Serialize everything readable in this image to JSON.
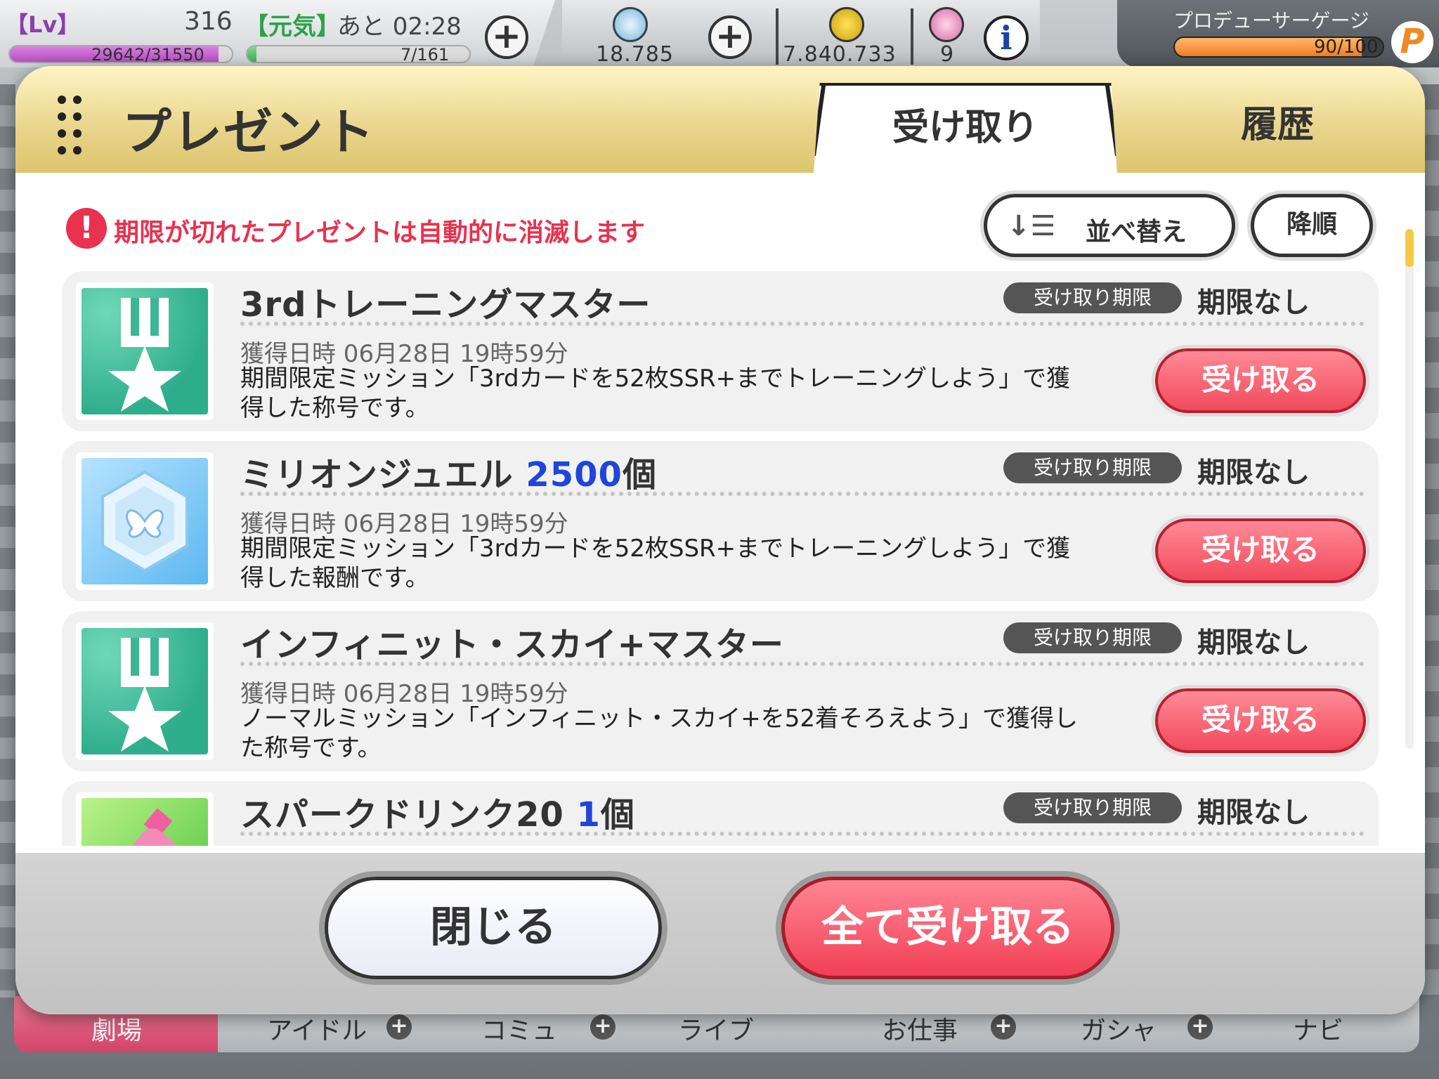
{
  "status": {
    "lv_badge": "【Lv】",
    "level": "316",
    "genki": "【元気】",
    "time_left": "あと 02:28",
    "exp_text": "29642/31550",
    "exp_ratio": 0.94,
    "stamina_text": "7/161",
    "stamina_ratio": 0.04
  },
  "currency": {
    "jewels": "18.785",
    "money": "7.840.733",
    "tickets": "9"
  },
  "producer": {
    "label": "プロデューサーゲージ",
    "gauge_text": "90/100",
    "gauge_ratio": 0.9,
    "icon_letter": "P"
  },
  "modal": {
    "title": "プレゼント",
    "tabs": {
      "receive": "受け取り",
      "history": "履歴"
    },
    "warning": "期限が切れたプレゼントは自動的に消滅します",
    "sort_icon": "↓☰",
    "sort_label": "並べ替え",
    "order_label": "降順",
    "items": [
      {
        "title": "3rdトレーニングマスター",
        "qty": "",
        "qty_unit": "",
        "thumb": "medal-icon",
        "limit_badge": "受け取り期限",
        "limit_value": "期限なし",
        "date": "獲得日時 06月28日 19時59分",
        "desc": "期間限定ミッション「3rdカードを52枚SSR+までトレーニングしよう」で獲得した称号です。",
        "button": "受け取る"
      },
      {
        "title": "ミリオンジュエル ",
        "qty": "2500",
        "qty_unit": "個",
        "thumb": "jewel-icon",
        "limit_badge": "受け取り期限",
        "limit_value": "期限なし",
        "date": "獲得日時 06月28日 19時59分",
        "desc": "期間限定ミッション「3rdカードを52枚SSR+までトレーニングしよう」で獲得した報酬です。",
        "button": "受け取る"
      },
      {
        "title": "インフィニット・スカイ+マスター",
        "qty": "",
        "qty_unit": "",
        "thumb": "medal-icon",
        "limit_badge": "受け取り期限",
        "limit_value": "期限なし",
        "date": "獲得日時 06月28日 19時59分",
        "desc": "ノーマルミッション「インフィニット・スカイ+を52着そろえよう」で獲得した称号です。",
        "button": "受け取る"
      },
      {
        "title": "スパークドリンク20 ",
        "qty": "1",
        "qty_unit": "個",
        "thumb": "drink-icon",
        "limit_badge": "受け取り期限",
        "limit_value": "期限なし",
        "date": "",
        "desc": "",
        "button": ""
      }
    ],
    "close_label": "閉じる",
    "receive_all_label": "全て受け取る"
  },
  "nav": {
    "theater": "劇場",
    "idol": "アイドル",
    "commu": "コミュ",
    "live": "ライブ",
    "work": "お仕事",
    "gacha": "ガシャ",
    "navi": "ナビ"
  },
  "colors": {
    "accent_red": "#e8324f",
    "header_gold": "#e8d48a",
    "qty_blue": "#2045d8"
  }
}
